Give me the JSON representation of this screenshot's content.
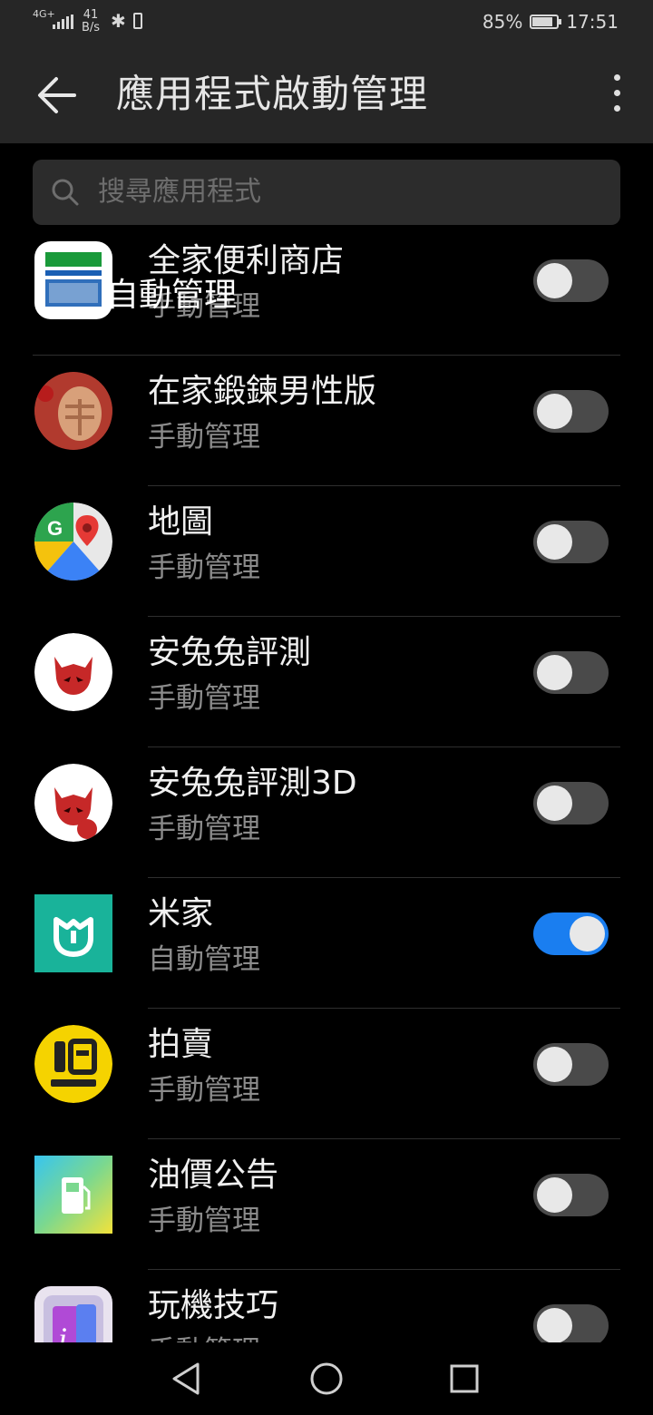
{
  "status_bar": {
    "network": "4G+",
    "speed_value": "41",
    "speed_unit": "B/s",
    "battery": "85%",
    "battery_level": 0.85,
    "time": "17:51",
    "bluetooth_icon": "bluetooth-icon",
    "vibrate_icon": "vibrate-icon"
  },
  "app_bar": {
    "title": "應用程式啟動管理",
    "back_icon": "arrow-left-icon",
    "more_icon": "more-vertical-icon"
  },
  "search": {
    "placeholder": "搜尋應用程式",
    "icon": "search-icon"
  },
  "overlay_text": "自動管理",
  "apps": [
    {
      "name": "全家便利商店",
      "status": "手動管理",
      "enabled": false,
      "icon": "familymart-icon"
    },
    {
      "name": "在家鍛鍊男性版",
      "status": "手動管理",
      "enabled": false,
      "icon": "bodybuilding-icon"
    },
    {
      "name": "地圖",
      "status": "手動管理",
      "enabled": false,
      "icon": "google-maps-icon"
    },
    {
      "name": "安兔兔評測",
      "status": "手動管理",
      "enabled": false,
      "icon": "antutu-icon"
    },
    {
      "name": "安兔兔評測3D",
      "status": "手動管理",
      "enabled": false,
      "icon": "antutu-3d-icon"
    },
    {
      "name": "米家",
      "status": "自動管理",
      "enabled": true,
      "icon": "mijia-icon"
    },
    {
      "name": "拍賣",
      "status": "手動管理",
      "enabled": false,
      "icon": "yahoo-auction-icon"
    },
    {
      "name": "油價公告",
      "status": "手動管理",
      "enabled": false,
      "icon": "fuel-price-icon"
    },
    {
      "name": "玩機技巧",
      "status": "手動管理",
      "enabled": false,
      "icon": "tips-icon"
    }
  ],
  "nav_bar": {
    "back_icon": "triangle-back-icon",
    "home_icon": "circle-home-icon",
    "recents_icon": "square-recents-icon"
  },
  "colors": {
    "toggle_on": "#1a7ef0",
    "toggle_off": "#4a4a4a",
    "bar_background": "#262626"
  }
}
